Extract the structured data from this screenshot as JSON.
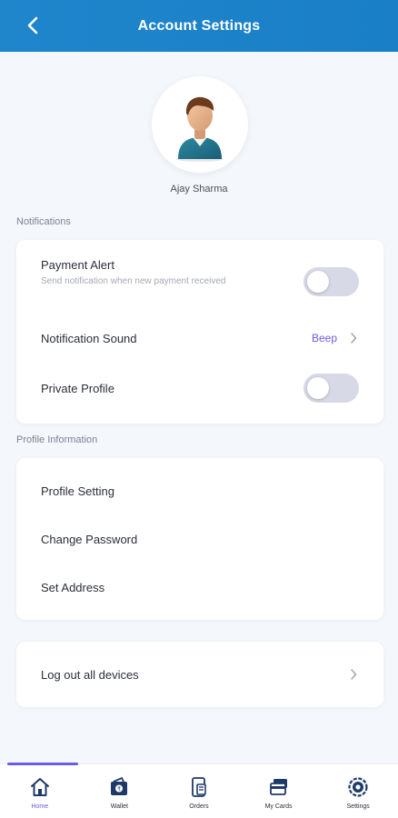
{
  "header": {
    "title": "Account Settings"
  },
  "profile": {
    "name": "Ajay Sharma"
  },
  "sections": {
    "notifications": "Notifications",
    "profile_information": "Profile Information"
  },
  "notifications": {
    "payment_alert": {
      "title": "Payment Alert",
      "description": "Send notification when new payment received",
      "enabled": false
    },
    "notification_sound": {
      "title": "Notification Sound",
      "value": "Beep"
    },
    "private_profile": {
      "title": "Private Profile",
      "enabled": false
    }
  },
  "profile_items": [
    "Profile Setting",
    "Change Password",
    "Set Address"
  ],
  "logout": {
    "label": "Log out all devices"
  },
  "bottom_nav": [
    {
      "label": "Home",
      "icon": "home-icon",
      "active": true
    },
    {
      "label": "Wallet",
      "icon": "wallet-icon",
      "active": false
    },
    {
      "label": "Orders",
      "icon": "orders-icon",
      "active": false
    },
    {
      "label": "My Cards",
      "icon": "cards-icon",
      "active": false
    },
    {
      "label": "Settings",
      "icon": "settings-icon",
      "active": false
    }
  ],
  "colors": {
    "header": "#1f86cc",
    "accent": "#6c5ce7",
    "toggle_off": "#d7d9e6",
    "background": "#f4f7fb"
  }
}
